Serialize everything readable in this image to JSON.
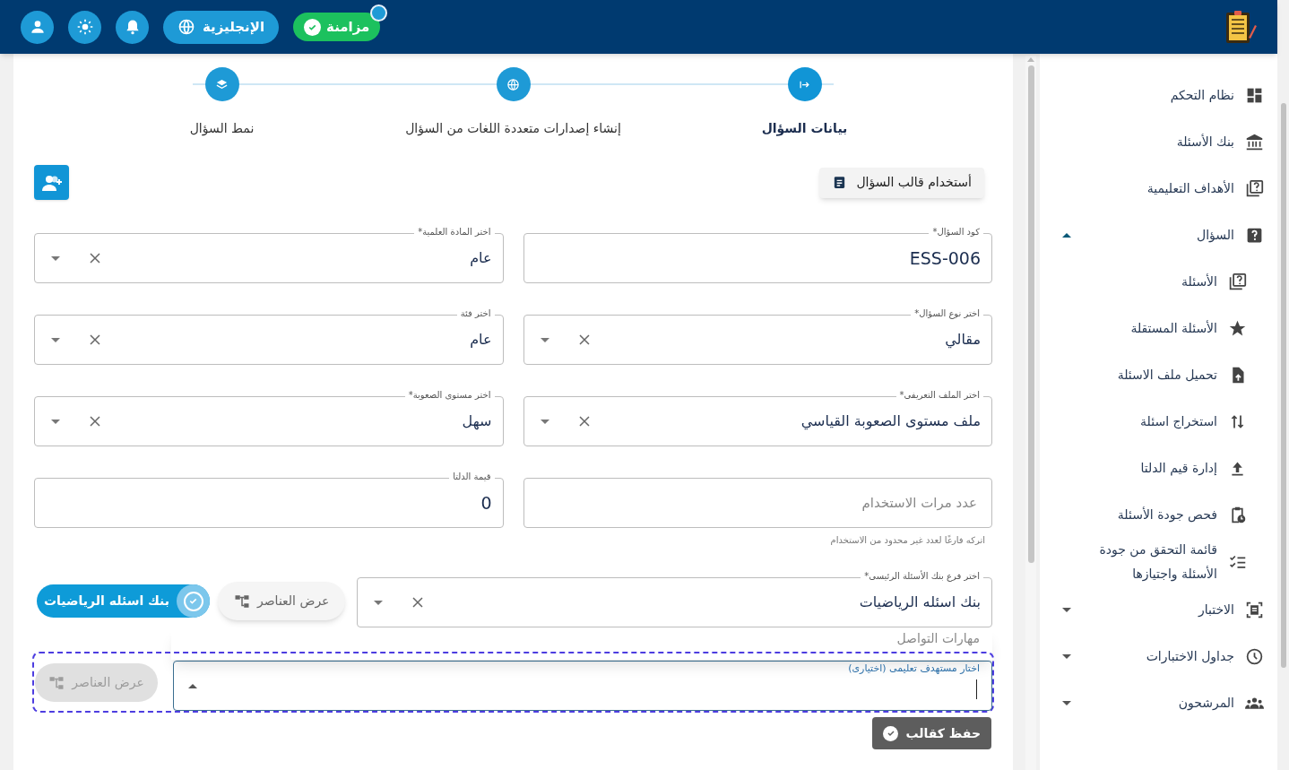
{
  "header": {
    "sync": {
      "label": "مزامنة",
      "checked": true,
      "notification_dot": true
    },
    "language": "الإنجليزية"
  },
  "stepper": [
    {
      "label": "بيانات السؤال",
      "selected": true,
      "kind": "arrow"
    },
    {
      "label": "إنشاء إصدارات متعددة اللغات من السؤال",
      "selected": false,
      "kind": "globe"
    },
    {
      "label": "نمط السؤال",
      "selected": false,
      "kind": "layers"
    }
  ],
  "template_button": "أستخدام قالب السؤال",
  "fields": [
    {
      "kind": "text",
      "label": "كود السؤال*",
      "value": "ESS-006"
    },
    {
      "kind": "select",
      "label": "اختر نوع السؤال*",
      "value": "مقالي"
    },
    {
      "kind": "select",
      "label": "اختر الملف التعريفى*",
      "value": "ملف مستوى الصعوبة القياسي"
    },
    {
      "kind": "text",
      "placeholder": "عدد مرات الاستخدام",
      "helper": "اتركه فارغًا لعدد غير محدود من الاستخدام"
    },
    {
      "kind": "select",
      "label": "اختر المادة العلمية*",
      "value": "عام"
    },
    {
      "kind": "select",
      "label": "اختر فئة",
      "value": "عام"
    },
    {
      "kind": "select",
      "label": "اختر مستوى الصعوبة*",
      "value": "سهل"
    },
    {
      "kind": "text",
      "label": "قيمة الدلتا",
      "value": "0"
    }
  ],
  "bank": {
    "label": "اختر فرع بنك الأسئلة الرئيسى*",
    "value": "بنك اسئله الرياضيات",
    "view_button": "عرض العناصر",
    "chip": {
      "label": "بنك اسئله الرياضيات",
      "checked": true
    },
    "options": [
      "مهارات التواصل"
    ]
  },
  "objective": {
    "label": "اختار مستهدف تعليمى (اختيارى)",
    "focused": true,
    "view_button": {
      "label": "عرض العناصر",
      "disabled": true
    }
  },
  "save_button": "حفظ كقالب",
  "sidebar": [
    {
      "label": "نظام التحكم",
      "kind": "dashboard"
    },
    {
      "label": "بنك الأسئلة",
      "kind": "bank"
    },
    {
      "label": "الأهداف التعليمية",
      "kind": "quiz"
    },
    {
      "label": "السؤال",
      "kind": "help",
      "expanded": true,
      "children": [
        {
          "label": "الأسئلة",
          "kind": "quiz"
        },
        {
          "label": "الأسئلة المستقلة",
          "kind": "star"
        },
        {
          "label": "تحميل ملف الاسئلة",
          "kind": "upload-file"
        },
        {
          "label": "استخراج اسئلة",
          "kind": "swap"
        },
        {
          "label": "إدارة قيم الدلتا",
          "kind": "upload"
        },
        {
          "label": "فحص جودة الأسئلة",
          "kind": "clipboard"
        },
        {
          "label": "قائمة التحقق من جودة الأسئلة واجتيازها",
          "kind": "checklist"
        }
      ]
    },
    {
      "label": "الاختبار",
      "kind": "exam",
      "expanded": false
    },
    {
      "label": "جداول الاختبارات",
      "kind": "clock",
      "expanded": false
    },
    {
      "label": "المرشحون",
      "kind": "people",
      "expanded": false
    }
  ]
}
